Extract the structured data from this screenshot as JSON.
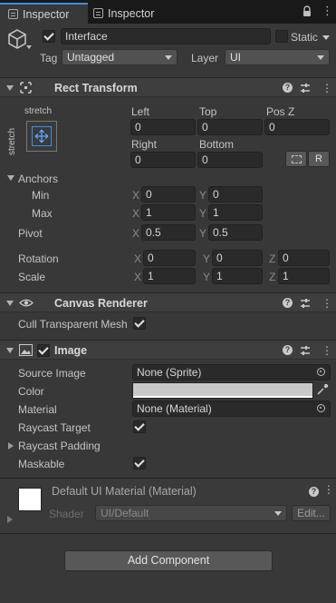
{
  "tabs": [
    {
      "label": "Inspector"
    },
    {
      "label": "Inspector"
    }
  ],
  "tab_tools": {
    "lock": "lock-icon",
    "menu": "⋮"
  },
  "gameobject": {
    "name": "Interface",
    "static_label": "Static",
    "tag_label": "Tag",
    "tag_value": "Untagged",
    "layer_label": "Layer",
    "layer_value": "UI"
  },
  "rect_transform": {
    "title": "Rect Transform",
    "anchor_preset_top": "stretch",
    "anchor_preset_side": "stretch",
    "left_label": "Left",
    "left_value": "0",
    "top_label": "Top",
    "top_value": "0",
    "posz_label": "Pos Z",
    "posz_value": "0",
    "right_label": "Right",
    "right_value": "0",
    "bottom_label": "Bottom",
    "bottom_value": "0",
    "r_button": "R",
    "anchors_label": "Anchors",
    "min_label": "Min",
    "min_x": "0",
    "min_y": "0",
    "max_label": "Max",
    "max_x": "1",
    "max_y": "1",
    "pivot_label": "Pivot",
    "pivot_x": "0.5",
    "pivot_y": "0.5",
    "rotation_label": "Rotation",
    "rot_x": "0",
    "rot_y": "0",
    "rot_z": "0",
    "scale_label": "Scale",
    "scale_x": "1",
    "scale_y": "1",
    "scale_z": "1",
    "x": "X",
    "y": "Y",
    "z": "Z"
  },
  "canvas_renderer": {
    "title": "Canvas Renderer",
    "cull_label": "Cull Transparent Mesh",
    "cull_checked": true
  },
  "image": {
    "title": "Image",
    "source_label": "Source Image",
    "source_value": "None (Sprite)",
    "color_label": "Color",
    "color_value": "#c8c8c8",
    "material_label": "Material",
    "material_value": "None (Material)",
    "raycast_label": "Raycast Target",
    "raycast_padding_label": "Raycast Padding",
    "maskable_label": "Maskable"
  },
  "material_preview": {
    "title": "Default UI Material (Material)",
    "shader_label": "Shader",
    "shader_value": "UI/Default",
    "edit_button": "Edit..."
  },
  "add_component": "Add Component",
  "colors": {
    "accent": "#3d8ee6",
    "panel": "#383838",
    "header": "#3e3e3e",
    "field": "#2a2a2a"
  }
}
